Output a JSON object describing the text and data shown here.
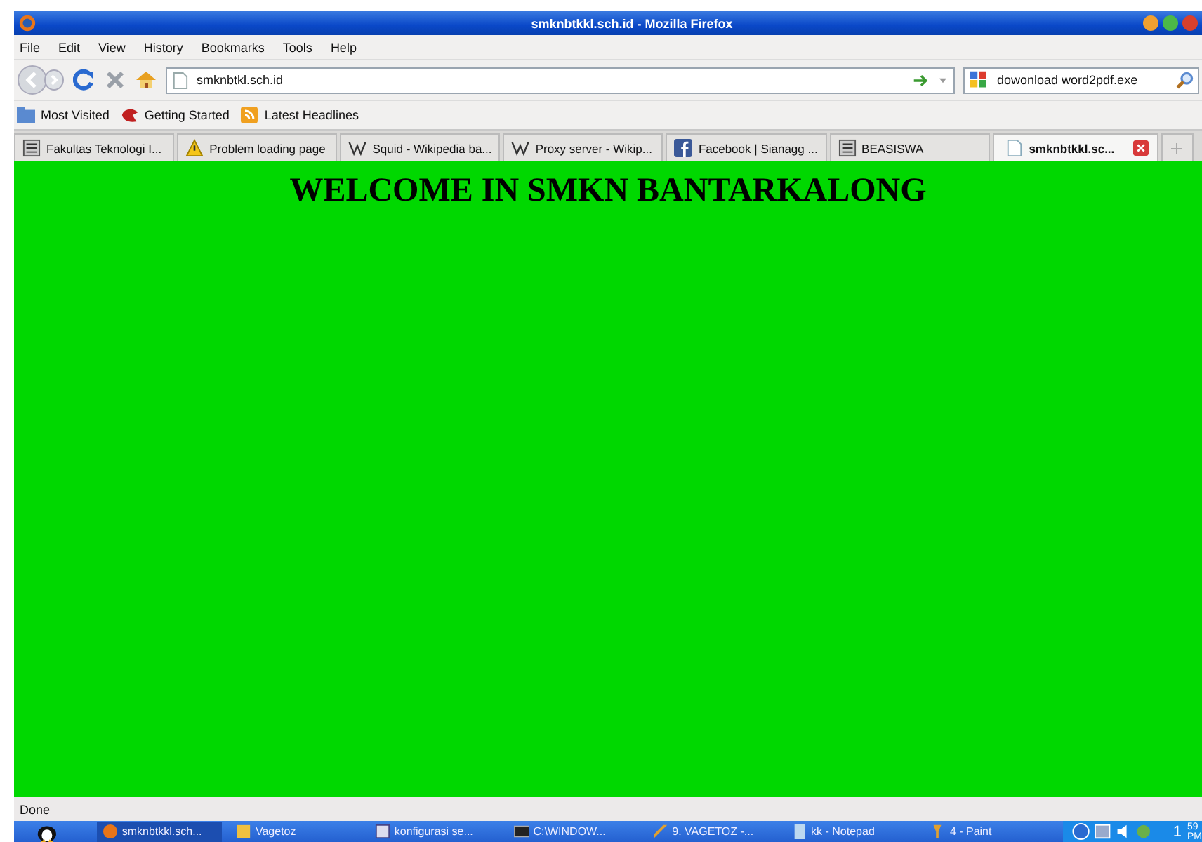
{
  "window": {
    "title": "smknbtkkl.sch.id - Mozilla Firefox"
  },
  "menu": [
    {
      "label": "File"
    },
    {
      "label": "Edit"
    },
    {
      "label": "View"
    },
    {
      "label": "History"
    },
    {
      "label": "Bookmarks"
    },
    {
      "label": "Tools"
    },
    {
      "label": "Help"
    }
  ],
  "address_bar": {
    "value": "smknbtkl.sch.id"
  },
  "search": {
    "value": "dowonload word2pdf.exe"
  },
  "bookmarks": [
    {
      "label": "Most Visited",
      "kind": "folder"
    },
    {
      "label": "Getting Started",
      "kind": "bird"
    },
    {
      "label": "Latest Headlines",
      "kind": "feed"
    }
  ],
  "tabs": [
    {
      "label": "Fakultas Teknologi I...",
      "kind": "site",
      "selected": false
    },
    {
      "label": "Problem loading page",
      "kind": "warning",
      "selected": false
    },
    {
      "label": "Squid - Wikipedia ba...",
      "kind": "wiki",
      "selected": false
    },
    {
      "label": "Proxy server - Wikip...",
      "kind": "wiki",
      "selected": false
    },
    {
      "label": "Facebook | Sianagg ...",
      "kind": "facebook",
      "selected": false
    },
    {
      "label": "BEASISWA",
      "kind": "site",
      "selected": false
    },
    {
      "label": "smknbtkkl.sc...",
      "kind": "page",
      "selected": true
    }
  ],
  "page": {
    "heading": "WELCOME IN SMKN BANTARKALONG"
  },
  "status_bar": {
    "text": "Done"
  },
  "taskbar": {
    "items": [
      {
        "label": "smknbtkkl.sch...",
        "kind": "firefox",
        "selected": true
      },
      {
        "label": "Vagetoz",
        "kind": "folder",
        "selected": false
      },
      {
        "label": "konfigurasi se...",
        "kind": "doc",
        "selected": false
      },
      {
        "label": "C:\\WINDOW...",
        "kind": "cmd",
        "selected": false
      },
      {
        "label": "9. VAGETOZ -...",
        "kind": "tool",
        "selected": false
      },
      {
        "label": "kk - Notepad",
        "kind": "notepad",
        "selected": false
      },
      {
        "label": "4 - Paint",
        "kind": "paint",
        "selected": false
      }
    ],
    "clock": {
      "hour": "1",
      "minute": "59",
      "period": "PM"
    }
  }
}
